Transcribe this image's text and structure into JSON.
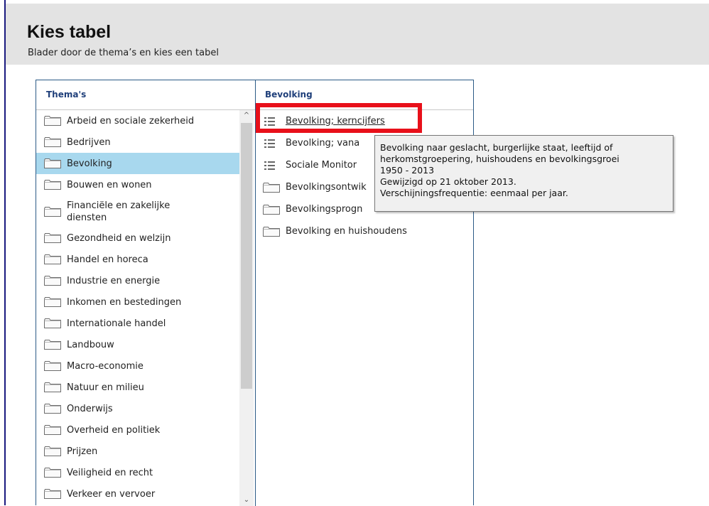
{
  "header": {
    "title": "Kies tabel",
    "subtitle": "Blader door de thema’s en kies een tabel"
  },
  "columns": {
    "themes_heading": "Thema's",
    "tables_heading": "Bevolking"
  },
  "themes": [
    {
      "label": "Arbeid en sociale zekerheid",
      "selected": false
    },
    {
      "label": "Bedrijven",
      "selected": false
    },
    {
      "label": "Bevolking",
      "selected": true
    },
    {
      "label": "Bouwen en wonen",
      "selected": false
    },
    {
      "label": "Financiële en zakelijke diensten",
      "selected": false
    },
    {
      "label": "Gezondheid en welzijn",
      "selected": false
    },
    {
      "label": "Handel en horeca",
      "selected": false
    },
    {
      "label": "Industrie en energie",
      "selected": false
    },
    {
      "label": "Inkomen en bestedingen",
      "selected": false
    },
    {
      "label": "Internationale handel",
      "selected": false
    },
    {
      "label": "Landbouw",
      "selected": false
    },
    {
      "label": "Macro-economie",
      "selected": false
    },
    {
      "label": "Natuur en milieu",
      "selected": false
    },
    {
      "label": "Onderwijs",
      "selected": false
    },
    {
      "label": "Overheid en politiek",
      "selected": false
    },
    {
      "label": "Prijzen",
      "selected": false
    },
    {
      "label": "Veiligheid en recht",
      "selected": false
    },
    {
      "label": "Verkeer en vervoer",
      "selected": false
    }
  ],
  "tables": [
    {
      "label": "Bevolking; kerncijfers",
      "type": "table",
      "icon": "list-icon"
    },
    {
      "label": "Bevolking; vana",
      "type": "table",
      "icon": "list-icon"
    },
    {
      "label": "Sociale Monitor",
      "type": "table",
      "icon": "list-icon"
    },
    {
      "label": "Bevolkingsontwik",
      "type": "folder",
      "icon": "folder-icon"
    },
    {
      "label": "Bevolkingsprogn",
      "type": "folder",
      "icon": "folder-icon"
    },
    {
      "label": "Bevolking en huishoudens",
      "type": "folder",
      "icon": "folder-icon"
    }
  ],
  "tooltip": {
    "line1": "Bevolking naar geslacht, burgerlijke staat, leeftijd of",
    "line2": "herkomstgroepering, huishoudens en bevolkingsgroei",
    "line3": "1950 - 2013",
    "line4": "Gewijzigd op 21 oktober 2013.",
    "line5": "Verschijningsfrequentie: eenmaal per jaar."
  },
  "colors": {
    "selected_background": "#a8d8ee",
    "highlight_border": "#e8101a",
    "heading_text": "#1f3f7a"
  }
}
